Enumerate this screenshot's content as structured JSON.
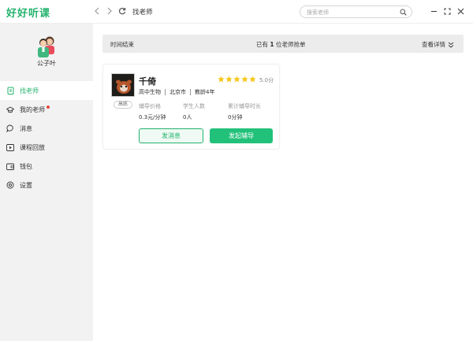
{
  "app": {
    "logo": "好好听课",
    "page_title": "找老师",
    "search_placeholder": "搜索老师"
  },
  "icons": {
    "back": "chevron-left-icon",
    "forward": "chevron-right-icon",
    "refresh": "refresh-icon",
    "search": "search-icon",
    "minimize": "minimize-icon",
    "fullscreen": "fullscreen-icon",
    "close": "close-icon"
  },
  "user": {
    "name": "公子叶"
  },
  "sidebar": {
    "items": [
      {
        "label": "找老师",
        "icon": "clipboard-icon",
        "active": true
      },
      {
        "label": "我的老师",
        "icon": "mortarboard-icon",
        "badge": true
      },
      {
        "label": "消息",
        "icon": "chat-bubble-icon"
      },
      {
        "label": "课程回放",
        "icon": "play-icon"
      },
      {
        "label": "钱包",
        "icon": "wallet-icon"
      },
      {
        "label": "设置",
        "icon": "settings-icon"
      }
    ]
  },
  "infobar": {
    "left": "时间结束",
    "center_prefix": "已有 ",
    "center_count": "1",
    "center_suffix": " 位老师抢单",
    "right": "查看详情"
  },
  "teacher": {
    "name": "千倚",
    "rating": 5,
    "score": "5.0分",
    "tag": "高练",
    "subject": "高中生物",
    "city": "北京市",
    "experience": "教龄4年",
    "stats": [
      {
        "label": "辅导价格",
        "value": "0.3元/分钟"
      },
      {
        "label": "学生人数",
        "value": "0人"
      },
      {
        "label": "累计辅导时长",
        "value": "0分钟"
      }
    ],
    "btn_message": "发消息",
    "btn_tutor": "发起辅导"
  },
  "colors": {
    "accent": "#23b26d",
    "button": "#22c17a",
    "star": "#f5c518",
    "badge": "#e5463f"
  }
}
